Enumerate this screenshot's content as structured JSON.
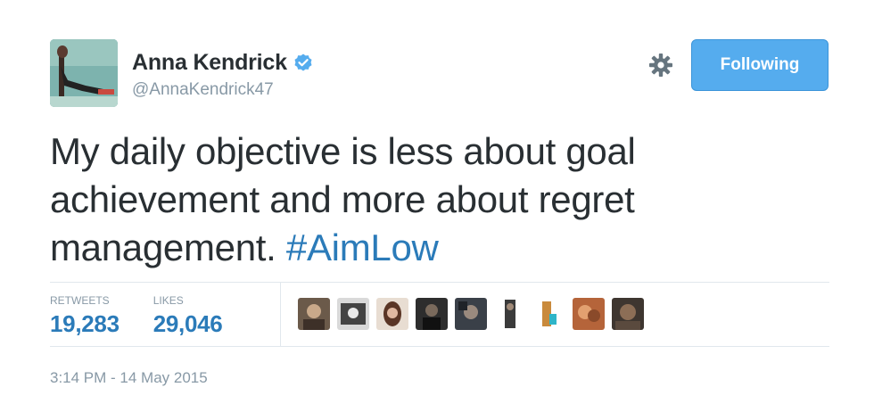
{
  "author": {
    "display_name": "Anna Kendrick",
    "handle": "@AnnaKendrick47",
    "verified": true
  },
  "actions": {
    "settings_icon": "gear-icon",
    "follow_label": "Following"
  },
  "tweet": {
    "text_before": "My daily objective is less about goal achievement and more about regret management.",
    "hashtag": "#AimLow"
  },
  "stats": {
    "retweets_label": "RETWEETS",
    "retweets_value": "19,283",
    "likes_label": "LIKES",
    "likes_value": "29,046"
  },
  "likers_count_shown": 9,
  "timestamp": "3:14 PM - 14 May 2015",
  "colors": {
    "link": "#2b7bb9",
    "button": "#55acee",
    "muted": "#8899a6",
    "divider": "#e1e8ed"
  }
}
